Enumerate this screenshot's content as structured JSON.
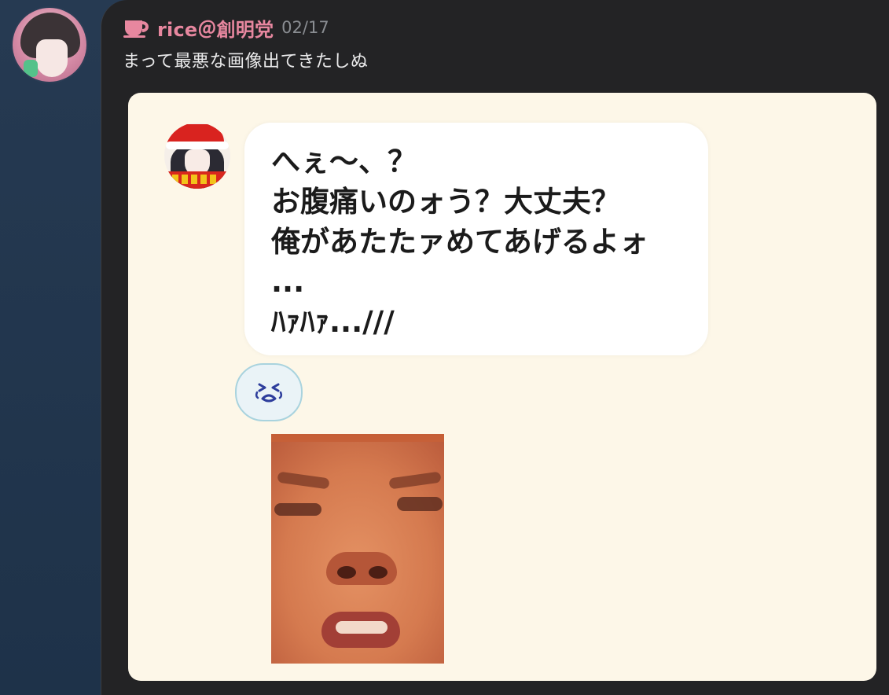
{
  "post": {
    "username": "rice＠創明党",
    "timestamp": "02/17",
    "text": "まって最悪な画像出てきたしぬ"
  },
  "embed": {
    "bubble_text": "へぇ〜、？\nお腹痛いのォう？大丈夫？\n俺があたたァめてあげるよォ\n...\nﾊｧﾊｧ...///",
    "reaction_emoji": "😭"
  },
  "icons": {
    "cup": "coffee-cup-icon",
    "reaction": "crying-face-icon"
  },
  "colors": {
    "username": "#e7879f",
    "card_bg": "#232325",
    "embed_bg": "#fdf7e8",
    "page_bg": "#263a52"
  }
}
